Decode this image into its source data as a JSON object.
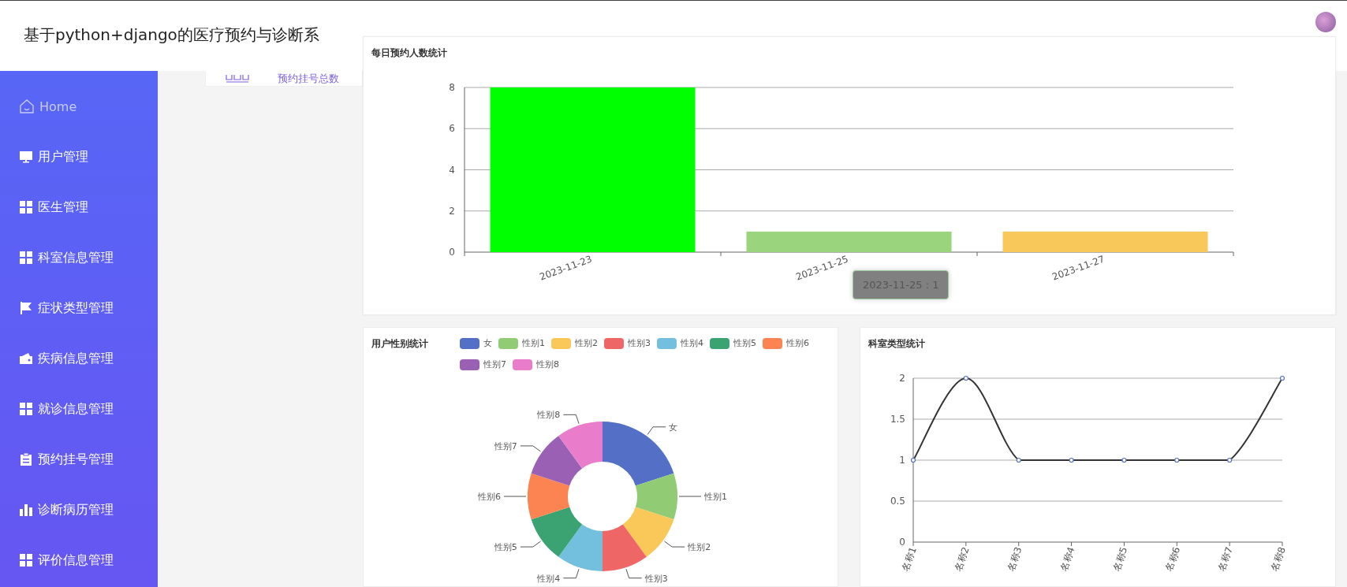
{
  "header": {
    "title": "基于python+django的医疗预约与诊断系"
  },
  "sidebar": {
    "items": [
      {
        "label": "Home",
        "selected": true
      },
      {
        "label": "用户管理",
        "selected": false
      },
      {
        "label": "医生管理",
        "selected": false
      },
      {
        "label": "科室信息管理",
        "selected": false
      },
      {
        "label": "症状类型管理",
        "selected": false
      },
      {
        "label": "疾病信息管理",
        "selected": false
      },
      {
        "label": "就诊信息管理",
        "selected": false
      },
      {
        "label": "预约挂号管理",
        "selected": false
      },
      {
        "label": "诊断病历管理",
        "selected": false
      },
      {
        "label": "评价信息管理",
        "selected": false
      }
    ]
  },
  "stat_card": {
    "label": "预约挂号总数"
  },
  "daily_chart": {
    "title": "每日预约人数统计",
    "tooltip": "2023-11-25 : 1",
    "chart_data": {
      "type": "bar",
      "categories": [
        "2023-11-23",
        "2023-11-25",
        "2023-11-27"
      ],
      "stacked": true,
      "grid": true,
      "ylim": [
        0,
        8
      ],
      "yticks": [
        0,
        2,
        4,
        6,
        8
      ],
      "series": [
        {
          "color": "#00ff00",
          "values": [
            8,
            null,
            null
          ]
        },
        {
          "color": "#9ad47c",
          "values": [
            null,
            1,
            null
          ]
        },
        {
          "color": "#f9c85b",
          "values": [
            null,
            null,
            1
          ]
        }
      ]
    }
  },
  "gender_chart": {
    "title": "用户性别统计",
    "legend": [
      {
        "label": "女",
        "color": "#5470c6"
      },
      {
        "label": "性别1",
        "color": "#91cc75"
      },
      {
        "label": "性别2",
        "color": "#fac858"
      },
      {
        "label": "性别3",
        "color": "#ee6666"
      },
      {
        "label": "性别4",
        "color": "#73c0de"
      },
      {
        "label": "性别5",
        "color": "#3ba272"
      },
      {
        "label": "性别6",
        "color": "#fc8452"
      },
      {
        "label": "性别7",
        "color": "#9a60b4"
      },
      {
        "label": "性别8",
        "color": "#ea7ccc"
      }
    ],
    "chart_data": {
      "type": "donut",
      "categories": [
        "女",
        "性别1",
        "性别2",
        "性别3",
        "性别4",
        "性别5",
        "性别6",
        "性别7",
        "性别8"
      ],
      "values": [
        2,
        1,
        1,
        1,
        1,
        1,
        1,
        1,
        1
      ]
    }
  },
  "department_chart": {
    "title": "科室类型统计",
    "chart_data": {
      "type": "line",
      "categories": [
        "名称1",
        "名称2",
        "名称3",
        "名称4",
        "名称5",
        "名称6",
        "名称7",
        "名称8"
      ],
      "grid": true,
      "ylim": [
        0,
        2
      ],
      "yticks": [
        0,
        0.5,
        1,
        1.5,
        2
      ],
      "series": [
        {
          "color": "#333333",
          "marker": true,
          "values": [
            1,
            2,
            1,
            1,
            1,
            1,
            1,
            2
          ]
        }
      ]
    }
  }
}
